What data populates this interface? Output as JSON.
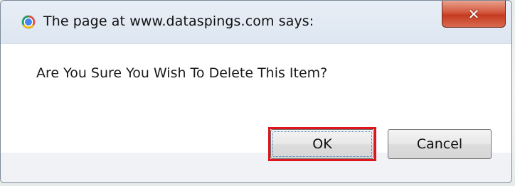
{
  "dialog": {
    "title": "The page at www.dataspings.com says:",
    "message": "Are You Sure You Wish To Delete This Item?",
    "close_icon": "close-icon",
    "title_icon": "chrome-icon"
  },
  "buttons": {
    "ok_label": "OK",
    "cancel_label": "Cancel"
  },
  "colors": {
    "highlight": "#e0141c",
    "close_button": "#c43b20"
  }
}
